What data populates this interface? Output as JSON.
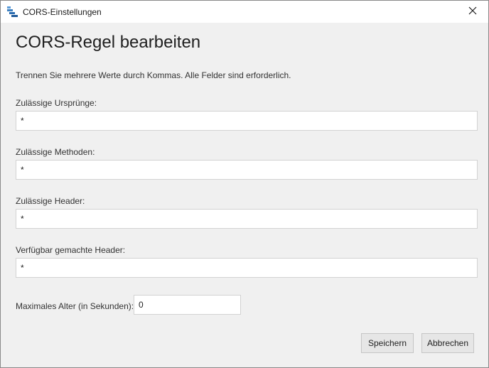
{
  "window": {
    "title": "CORS-Einstellungen",
    "app_icon": "storage-explorer-icon",
    "close_icon": "close-icon"
  },
  "dialog": {
    "heading": "CORS-Regel bearbeiten",
    "instructions": "Trennen Sie mehrere Werte durch Kommas. Alle Felder sind erforderlich."
  },
  "fields": {
    "allowed_origins": {
      "label": "Zulässige Ursprünge:",
      "value": "*"
    },
    "allowed_methods": {
      "label": "Zulässige Methoden:",
      "value": "*"
    },
    "allowed_headers": {
      "label": "Zulässige Header:",
      "value": "*"
    },
    "exposed_headers": {
      "label": "Verfügbar gemachte Header:",
      "value": "*"
    },
    "max_age": {
      "label": "Maximales Alter (in Sekunden):",
      "value": "0"
    }
  },
  "buttons": {
    "save": "Speichern",
    "cancel": "Abbrechen"
  }
}
